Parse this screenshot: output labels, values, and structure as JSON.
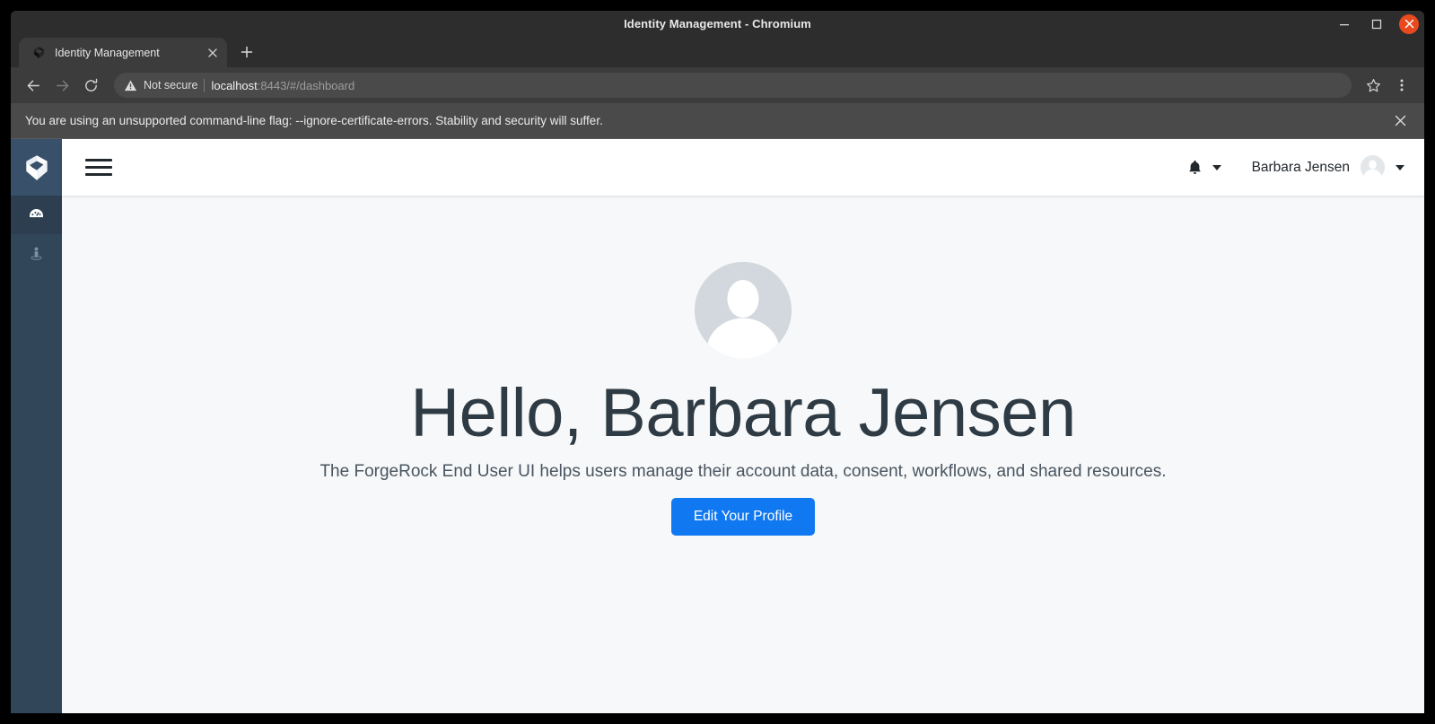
{
  "window": {
    "title": "Identity Management - Chromium",
    "controls": {
      "minimize": "minimize-icon",
      "maximize": "maximize-icon",
      "close": "close-icon"
    }
  },
  "browser": {
    "tabs": [
      {
        "title": "Identity Management",
        "favicon": "forgerock-logo-icon",
        "active": true
      }
    ],
    "new_tab_label": "+",
    "nav": {
      "back": "back-arrow-icon",
      "forward": "forward-arrow-icon",
      "reload": "reload-icon"
    },
    "omnibox": {
      "security_label": "Not secure",
      "security_icon": "warning-triangle-icon",
      "url_host": "localhost",
      "url_rest": ":8443/#/dashboard",
      "bookmark_icon": "star-icon",
      "menu_icon": "three-dot-menu-icon"
    },
    "infobar": {
      "message": "You are using an unsupported command-line flag: --ignore-certificate-errors. Stability and security will suffer.",
      "close_icon": "close-icon"
    }
  },
  "app": {
    "sidebar": {
      "logo": "forgerock-logo-icon",
      "items": [
        {
          "name": "dashboard",
          "icon": "dashboard-gauge-icon",
          "active": true
        },
        {
          "name": "profile",
          "icon": "person-on-platform-icon",
          "active": false
        }
      ]
    },
    "header": {
      "menu_icon": "hamburger-menu-icon",
      "notifications_icon": "bell-icon",
      "notifications_caret": "chevron-down-icon",
      "user_name": "Barbara Jensen",
      "user_avatar": "avatar-placeholder-icon",
      "user_caret": "chevron-down-icon"
    },
    "main": {
      "avatar": "avatar-placeholder-icon",
      "greeting": "Hello, Barbara Jensen",
      "description": "The ForgeRock End User UI helps users manage their account data, consent, workflows, and shared resources.",
      "primary_button": "Edit Your Profile"
    }
  },
  "colors": {
    "accent_blue": "#1078f0",
    "sidebar_bg": "#32465a",
    "sidebar_logo_bg": "#38506a",
    "sidebar_active_bg": "#2c3e50",
    "content_bg": "#f6f8f9",
    "heading": "#2f3b44",
    "close_button": "#e8491f"
  }
}
